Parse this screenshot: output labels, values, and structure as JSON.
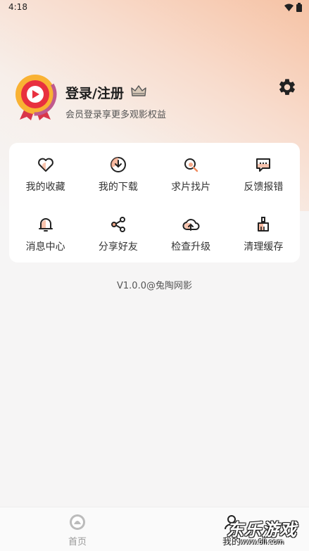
{
  "status_bar": {
    "time": "4:18"
  },
  "profile": {
    "title": "登录/注册",
    "subtitle": "会员登录享更多观影权益"
  },
  "menu": [
    {
      "label": "我的收藏",
      "icon": "heart-icon"
    },
    {
      "label": "我的下载",
      "icon": "download-icon"
    },
    {
      "label": "求片找片",
      "icon": "search-film-icon"
    },
    {
      "label": "反馈报错",
      "icon": "feedback-icon"
    },
    {
      "label": "消息中心",
      "icon": "bell-icon"
    },
    {
      "label": "分享好友",
      "icon": "share-icon"
    },
    {
      "label": "检查升级",
      "icon": "cloud-upload-icon"
    },
    {
      "label": "清理缓存",
      "icon": "broom-icon"
    }
  ],
  "version": "V1.0.0@兔陶网影",
  "tabbar": {
    "home": "首页",
    "mine": "我的"
  },
  "watermark": {
    "main": "东乐游戏",
    "url": "www.6ll.com"
  },
  "colors": {
    "accent": "#f08a5d",
    "icon_stroke": "#222222",
    "card_bg": "#ffffff"
  }
}
